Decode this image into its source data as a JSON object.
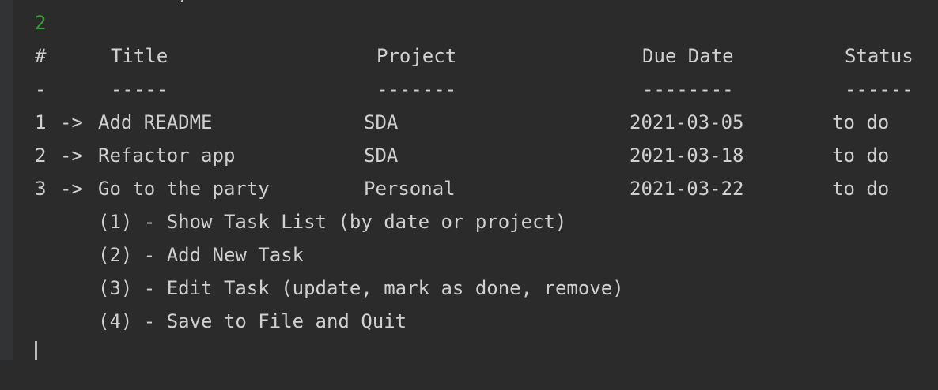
{
  "console": {
    "clipped_top_text": ")",
    "user_input": "2",
    "table": {
      "headers": {
        "num": "#",
        "title": "Title",
        "project": "Project",
        "due": "Due Date",
        "status": "Status"
      },
      "underlines": {
        "num": "-",
        "title": "-----",
        "project": "-------",
        "due": "--------",
        "status": "------"
      },
      "rows": [
        {
          "num": "1",
          "arrow": "->",
          "title": "Add README",
          "project": "SDA",
          "due": "2021-03-05",
          "status": "to do"
        },
        {
          "num": "2",
          "arrow": "->",
          "title": "Refactor app",
          "project": "SDA",
          "due": "2021-03-18",
          "status": "to do"
        },
        {
          "num": "3",
          "arrow": "->",
          "title": "Go to the party",
          "project": "Personal",
          "due": "2021-03-22",
          "status": "to do"
        }
      ]
    },
    "menu": [
      "(1) - Show Task List (by date or project)",
      "(2) - Add New Task",
      "(3) - Edit Task (update, mark as done, remove)",
      "(4) - Save to File and Quit"
    ]
  },
  "colors": {
    "background": "#2b2b2b",
    "text": "#d0d0d0",
    "user_input": "#3c9e3c"
  }
}
